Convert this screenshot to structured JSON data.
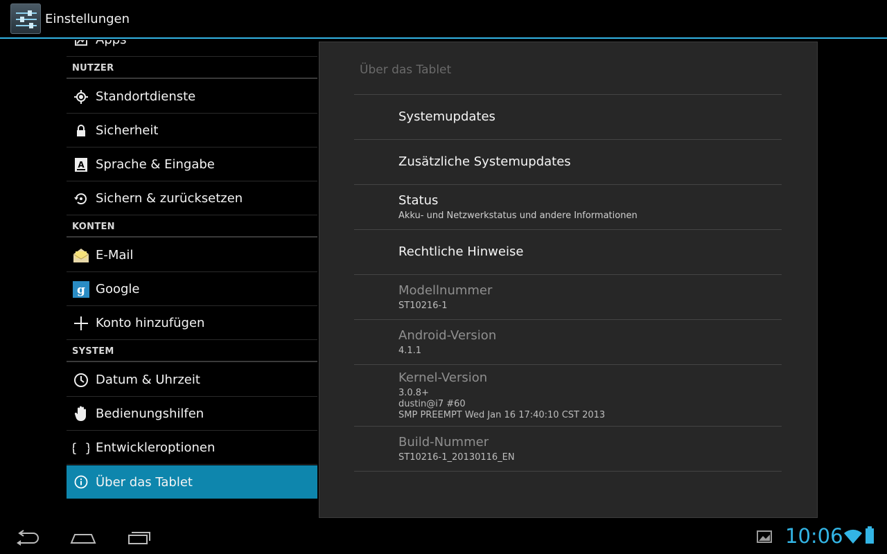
{
  "actionbar": {
    "title": "Einstellungen",
    "icon": "settings-sliders-icon"
  },
  "sidebar": {
    "partial_item": {
      "label": "Apps",
      "icon": "apps-icon"
    },
    "sections": [
      {
        "header": "NUTZER",
        "items": [
          {
            "label": "Standortdienste",
            "icon": "location-icon"
          },
          {
            "label": "Sicherheit",
            "icon": "lock-icon"
          },
          {
            "label": "Sprache & Eingabe",
            "icon": "keyboard-a-icon"
          },
          {
            "label": "Sichern & zurücksetzen",
            "icon": "backup-restore-icon"
          }
        ]
      },
      {
        "header": "KONTEN",
        "items": [
          {
            "label": "E-Mail",
            "icon": "email-envelope-icon"
          },
          {
            "label": "Google",
            "icon": "google-g-icon"
          },
          {
            "label": "Konto hinzufügen",
            "icon": "plus-icon"
          }
        ]
      },
      {
        "header": "SYSTEM",
        "items": [
          {
            "label": "Datum & Uhrzeit",
            "icon": "clock-icon"
          },
          {
            "label": "Bedienungshilfen",
            "icon": "hand-icon"
          },
          {
            "label": "Entwickleroptionen",
            "icon": "braces-icon"
          },
          {
            "label": "Über das Tablet",
            "icon": "info-icon",
            "selected": true
          }
        ]
      }
    ]
  },
  "detail": {
    "title": "Über das Tablet",
    "prefs": [
      {
        "title": "Systemupdates",
        "summary": ""
      },
      {
        "title": "Zusätzliche Systemupdates",
        "summary": ""
      },
      {
        "title": "Status",
        "summary": "Akku- und Netzwerkstatus und andere Informationen"
      },
      {
        "title": "Rechtliche Hinweise",
        "summary": ""
      },
      {
        "title": "Modellnummer",
        "summary": "ST10216-1"
      },
      {
        "title": "Android-Version",
        "summary": "4.1.1"
      },
      {
        "title": "Kernel-Version",
        "summary_lines": [
          "3.0.8+",
          "dustin@i7 #60",
          "SMP PREEMPT Wed Jan 16 17:40:10 CST 2013"
        ]
      },
      {
        "title": "Build-Nummer",
        "summary": "ST10216-1_20130116_EN"
      }
    ]
  },
  "statusbar": {
    "time": "10:06",
    "accent": "#33b5e5",
    "selected_bg": "#0e86ad"
  }
}
